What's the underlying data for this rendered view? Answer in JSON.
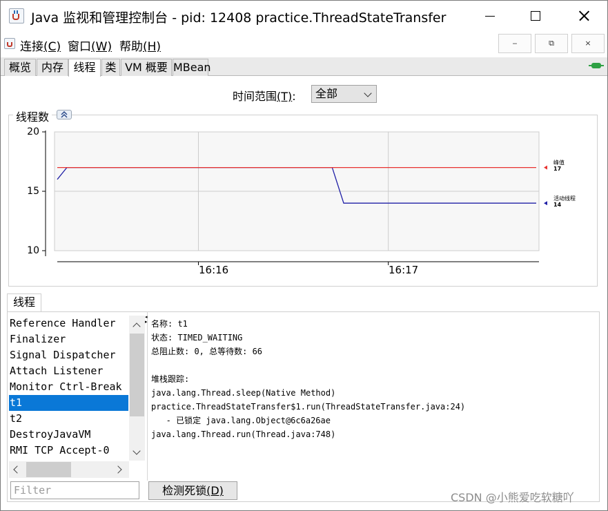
{
  "window": {
    "title": "Java 监视和管理控制台 - pid: 12408 practice.ThreadStateTransfer",
    "min_glyph": "—",
    "max_glyph": "☐",
    "close_glyph": "✕"
  },
  "menu": {
    "items": [
      {
        "label": "连接",
        "mnemonic": "(C)"
      },
      {
        "label": "窗口",
        "mnemonic": "(W)"
      },
      {
        "label": "帮助",
        "mnemonic": "(H)"
      }
    ],
    "mdi_buttons": [
      "‒",
      "⧉",
      "×"
    ]
  },
  "tabs": [
    {
      "label": "概览",
      "active": false
    },
    {
      "label": "内存",
      "active": false
    },
    {
      "label": "线程",
      "active": true
    },
    {
      "label": "类",
      "active": false
    },
    {
      "label": "VM 概要",
      "active": false
    },
    {
      "label": "MBean",
      "active": false
    }
  ],
  "time_range": {
    "label": "时间范围",
    "mnemonic": "(T)",
    "colon": ":",
    "selected": "全部"
  },
  "chart_panel": {
    "title": "线程数"
  },
  "chart_data": {
    "type": "line",
    "title": "线程数",
    "ylim": [
      10,
      20
    ],
    "yticks": [
      "20",
      "15",
      "10"
    ],
    "xticks": [
      "16:16",
      "16:17"
    ],
    "grid": true,
    "series": [
      {
        "name": "峰值",
        "value_label": "17",
        "color": "#e8312f",
        "x": [
          0.0,
          0.574,
          1.0
        ],
        "values": [
          17,
          17,
          17
        ]
      },
      {
        "name": "活动线程",
        "value_label": "14",
        "color": "#1f1fa6",
        "x": [
          0.0,
          0.02,
          0.574,
          0.598,
          1.0
        ],
        "values": [
          16,
          17,
          17,
          14,
          14
        ]
      }
    ]
  },
  "threads_section": {
    "tab_label": "线程",
    "list": [
      "Reference Handler",
      "Finalizer",
      "Signal Dispatcher",
      "Attach Listener",
      "Monitor Ctrl-Break",
      "t1",
      "t2",
      "DestroyJavaVM",
      "RMI TCP Accept-0"
    ],
    "selected_index": 5,
    "details": [
      "名称: t1",
      "状态: TIMED_WAITING",
      "总阻止数: 0, 总等待数: 66",
      "",
      "堆栈跟踪:",
      "java.lang.Thread.sleep(Native Method)",
      "practice.ThreadStateTransfer$1.run(ThreadStateTransfer.java:24)",
      "   - 已锁定 java.lang.Object@6c6a26ae",
      "java.lang.Thread.run(Thread.java:748)"
    ],
    "filter_placeholder": "Filter",
    "deadlock_button": {
      "label": "检测死锁",
      "mnemonic": "(D)"
    }
  },
  "watermark": "CSDN @小熊爱吃软糖吖"
}
